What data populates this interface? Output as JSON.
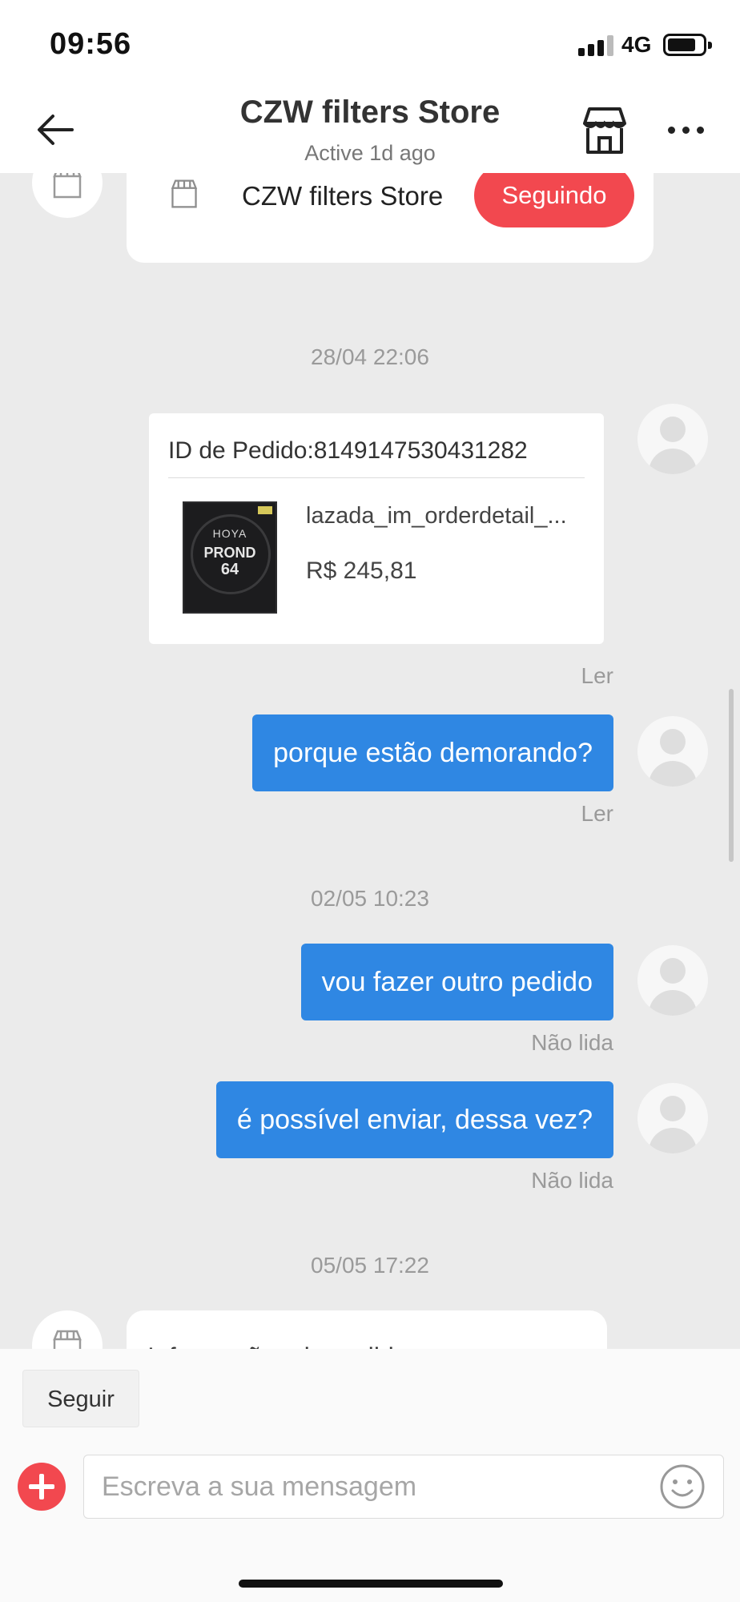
{
  "status_bar": {
    "time": "09:56",
    "network": "4G",
    "icons": [
      "signal-icon",
      "battery-icon"
    ]
  },
  "header": {
    "title": "CZW filters Store",
    "subtitle": "Active 1d ago",
    "icons": [
      "back-arrow-icon",
      "store-icon",
      "more-icon"
    ]
  },
  "store_card": {
    "name": "CZW filters Store",
    "follow_label": "Seguindo",
    "accent_color": "#f2484f"
  },
  "messages": {
    "ts1": "28/04 22:06",
    "order": {
      "id_text": "ID de Pedido:8149147530431282",
      "product_name": "lazada_im_orderdetail_...",
      "price": "R$ 245,81",
      "product_image": {
        "brand": "HOYA",
        "line": "PROND",
        "number": "64"
      }
    },
    "read1": "Ler",
    "msg1": "porque estão demorando?",
    "read2": "Ler",
    "ts2": "02/05 10:23",
    "msg2": "vou fazer outro pedido",
    "unread1": "Não lida",
    "msg3": "é possível enviar, dessa vez?",
    "unread2": "Não lida",
    "ts3": "05/05 17:22",
    "incoming_partial": "Informações do pedido",
    "bubble_color": "#2f87e3"
  },
  "bottom": {
    "follow_label": "Seguir",
    "input_placeholder": "Escreva a sua mensagem",
    "icons": [
      "plus-icon",
      "emoji-icon"
    ]
  }
}
